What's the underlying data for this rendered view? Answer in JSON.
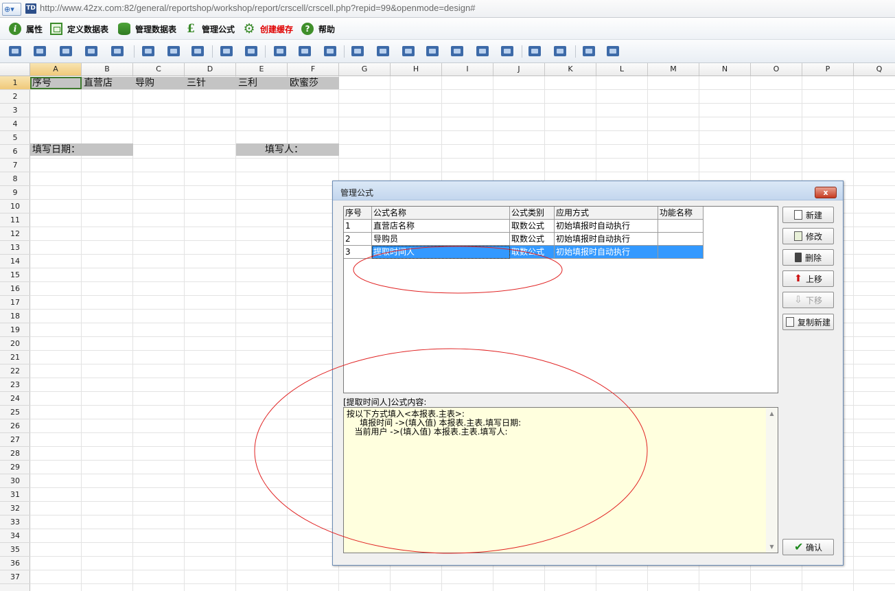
{
  "address_bar": {
    "url": "http://www.42zx.com:82/general/reportshop/workshop/report/crscell/crscell.php?repid=99&openmode=design#",
    "favicon_text": "TD"
  },
  "menu": {
    "items": [
      {
        "label": "属性",
        "icon": "info-icon"
      },
      {
        "label": "定义数据表",
        "icon": "table-define-icon"
      },
      {
        "label": "管理数据表",
        "icon": "database-icon"
      },
      {
        "label": "管理公式",
        "icon": "formula-pound-icon"
      },
      {
        "label": "创建缓存",
        "icon": "gear-icon",
        "color": "#e00000"
      },
      {
        "label": "帮助",
        "icon": "help-icon"
      }
    ]
  },
  "toolbar": {
    "icons": [
      "save-icon",
      "save-as-icon",
      "export-icon",
      "insert-image-icon",
      "image-props-icon",
      "page-setup-icon",
      "print-preview-icon",
      "print-icon",
      "undo-icon",
      "redo-icon",
      "cut-icon",
      "copy-icon",
      "paste-icon",
      "merge-cells-icon",
      "unmerge-cells-icon",
      "insert-row-icon",
      "delete-row-icon",
      "insert-col-icon",
      "delete-col-icon",
      "append-col-icon",
      "grid-icon",
      "chart-icon",
      "protect-icon",
      "settings-icon"
    ]
  },
  "sheet": {
    "columns": [
      "A",
      "B",
      "C",
      "D",
      "E",
      "F",
      "G",
      "H",
      "I",
      "J",
      "K",
      "L",
      "M",
      "N",
      "O",
      "P",
      "Q"
    ],
    "rows": [
      "1",
      "2",
      "3",
      "4",
      "5",
      "6",
      "7",
      "8",
      "9",
      "10",
      "11",
      "12",
      "13",
      "14",
      "15",
      "16",
      "17",
      "18",
      "19",
      "20",
      "21",
      "22",
      "23",
      "24",
      "25",
      "26",
      "27",
      "28",
      "29",
      "30",
      "31",
      "32",
      "33",
      "34",
      "35",
      "36",
      "37"
    ],
    "selected_column": "A",
    "selected_row": "1",
    "cells": {
      "A1": "序号",
      "B1": "直营店",
      "C1": "导购",
      "D1": "三针",
      "E1": "三利",
      "F1": "欧蜜莎",
      "A6": "填写日期：",
      "E6": "填写人："
    }
  },
  "dialog": {
    "title": "管理公式",
    "close_label": "x",
    "list": {
      "headers": [
        "序号",
        "公式名称",
        "公式类别",
        "应用方式",
        "功能名称"
      ],
      "rows": [
        [
          "1",
          "直营店名称",
          "取数公式",
          "初始填报时自动执行",
          ""
        ],
        [
          "2",
          "导购员",
          "取数公式",
          "初始填报时自动执行",
          ""
        ],
        [
          "3",
          "提取时间人",
          "取数公式",
          "初始填报时自动执行",
          ""
        ]
      ],
      "selected_row": 3
    },
    "content_label": "[提取时间人]公式内容:",
    "content_text": "按以下方式填入<本报表.主表>:\n     填报时间 ->(填入值) 本报表.主表.填写日期:\n   当前用户 ->(填入值) 本报表.主表.填写人:",
    "buttons": {
      "new": "新建",
      "edit": "修改",
      "delete": "删除",
      "up": "上移",
      "down": "下移",
      "copy_new": "复制新建",
      "ok": "确认"
    }
  },
  "colors": {
    "selection_blue": "#3399ff",
    "annotation_red": "#e02020",
    "content_bg": "#ffffde",
    "header_cell_gray": "#c4c4c4"
  }
}
